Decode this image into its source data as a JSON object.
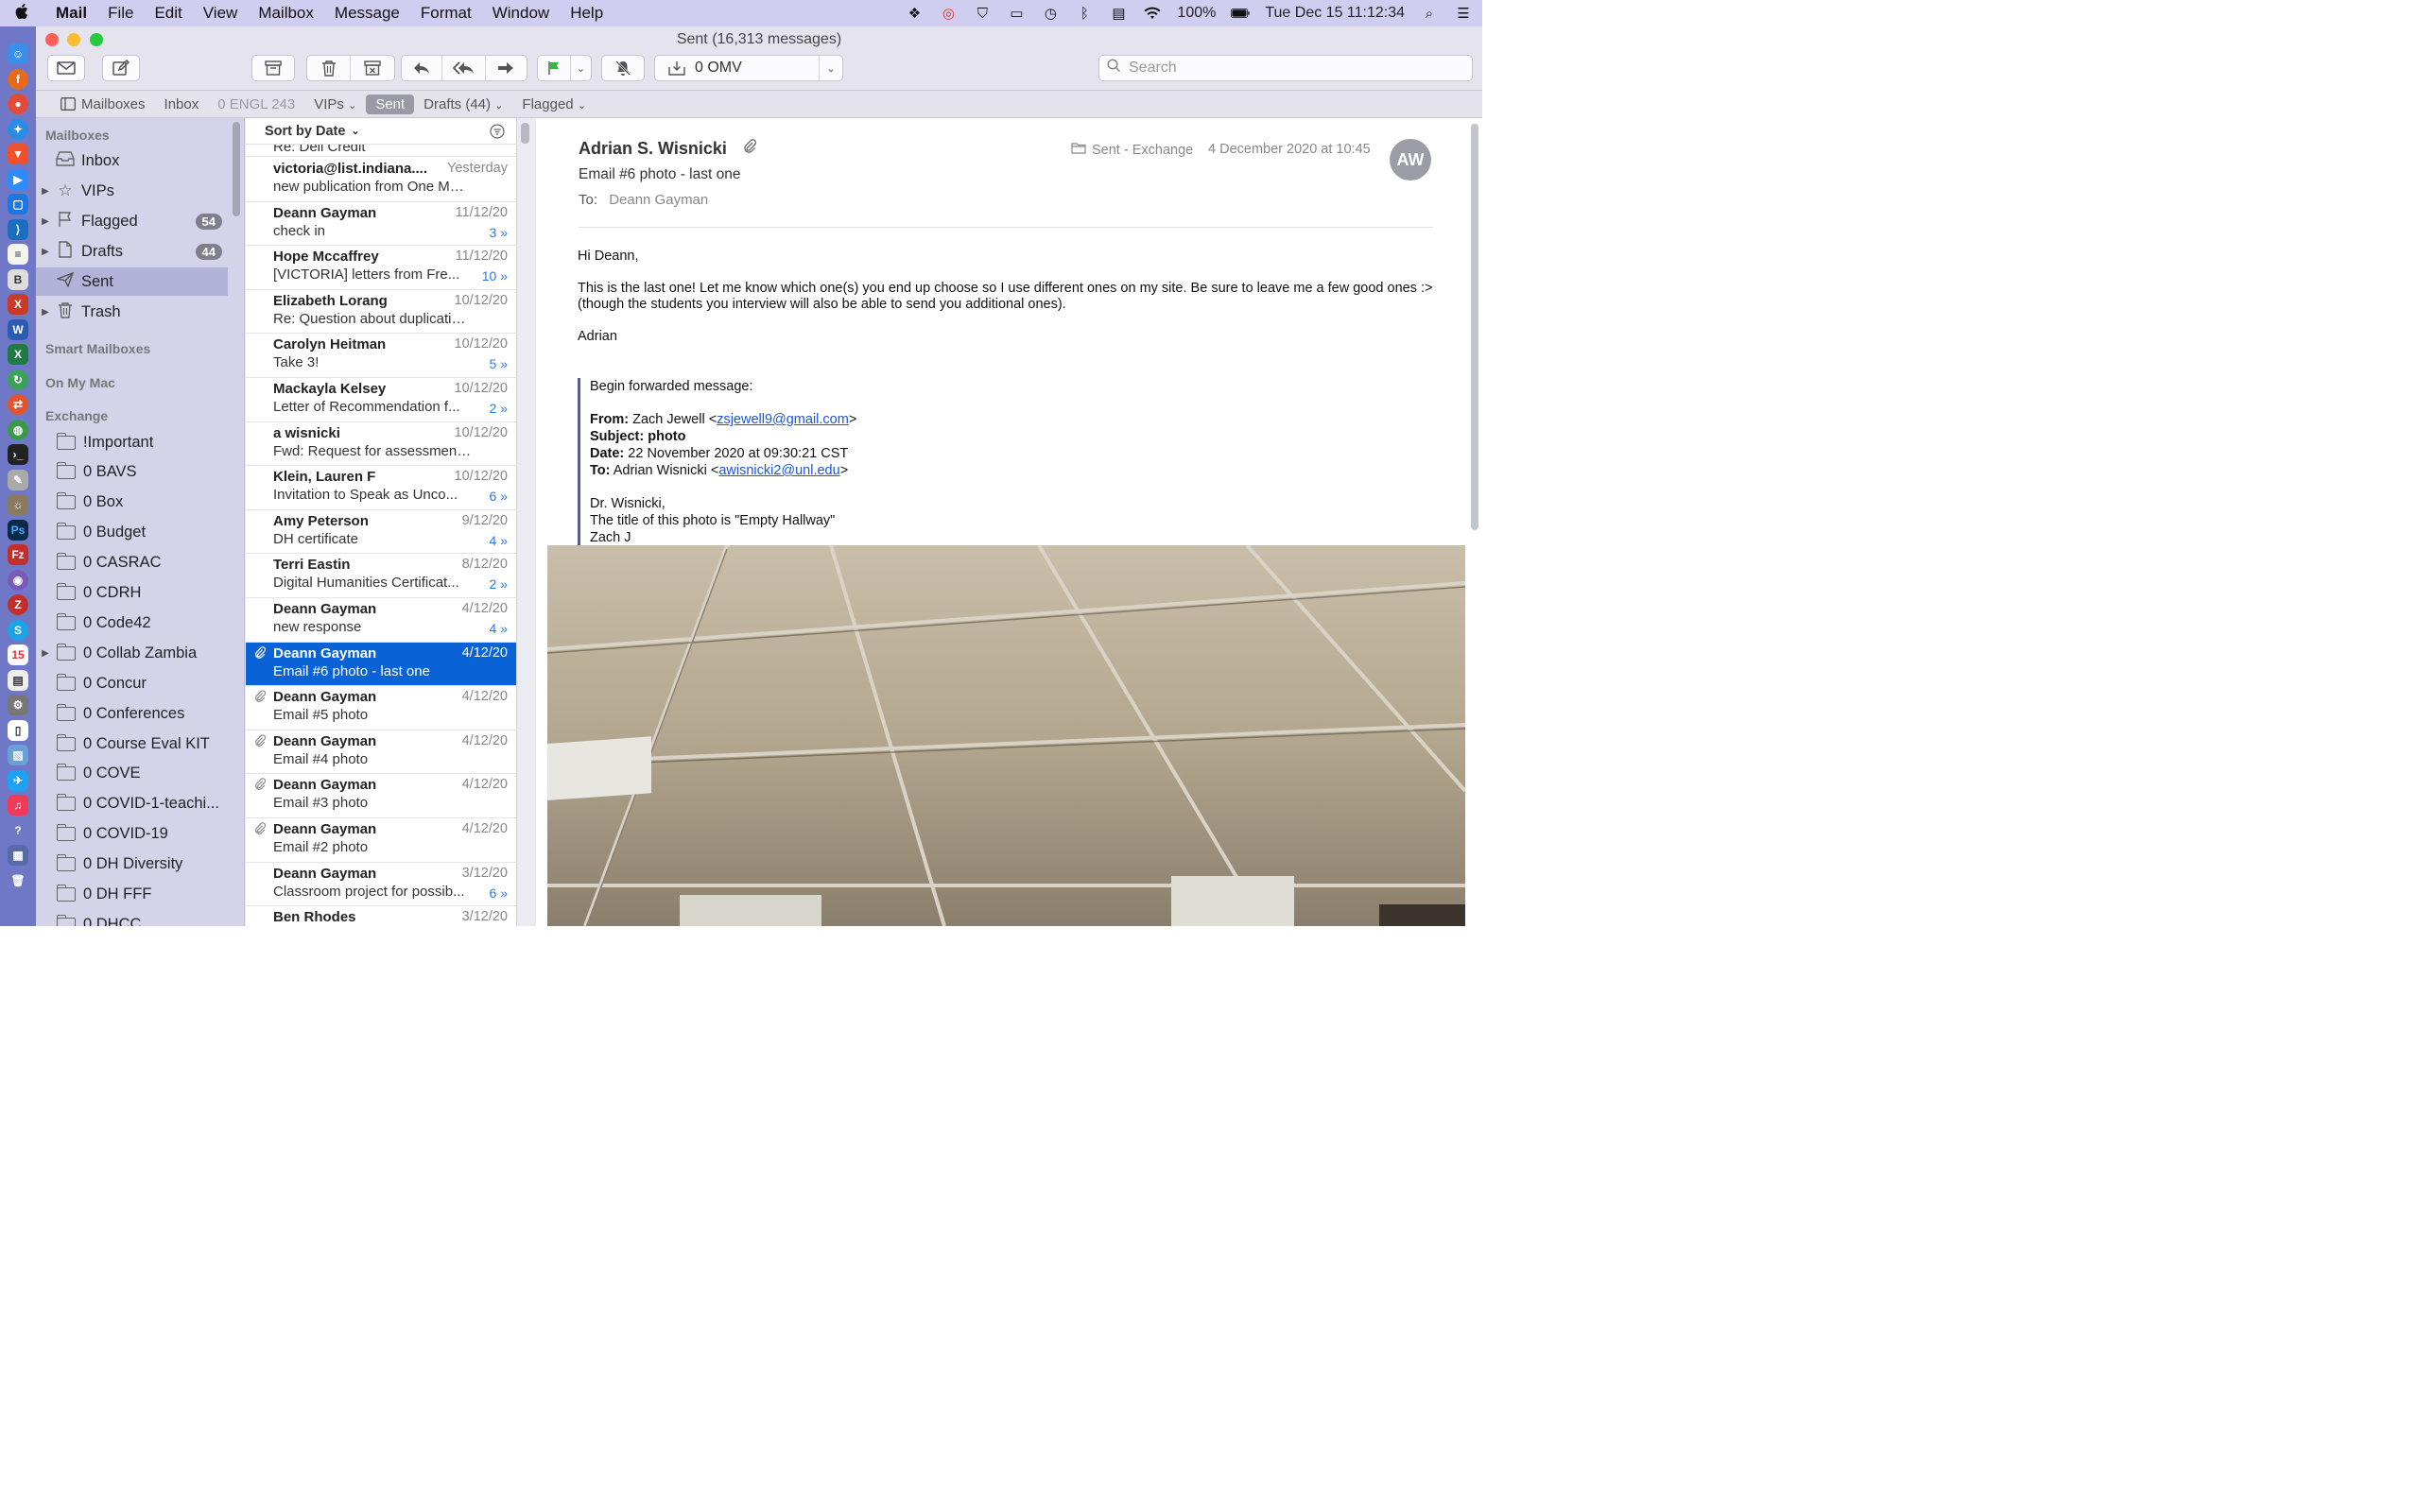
{
  "menubar": {
    "app": "Mail",
    "items": [
      "File",
      "Edit",
      "View",
      "Mailbox",
      "Message",
      "Format",
      "Window",
      "Help"
    ],
    "battery": "100%",
    "clock": "Tue Dec 15  11:12:34"
  },
  "window": {
    "title": "Sent (16,313 messages)"
  },
  "toolbar": {
    "mailbox_select": "0 OMV",
    "search_placeholder": "Search"
  },
  "favorites": {
    "mailboxes": "Mailboxes",
    "inbox": "Inbox",
    "engl": "0 ENGL 243",
    "vips": "VIPs",
    "sent": "Sent",
    "drafts": "Drafts (44)",
    "flagged": "Flagged"
  },
  "sidebar": {
    "section_mailboxes": "Mailboxes",
    "inbox": "Inbox",
    "vips": "VIPs",
    "flagged": "Flagged",
    "flagged_count": "54",
    "drafts": "Drafts",
    "drafts_count": "44",
    "sent": "Sent",
    "trash": "Trash",
    "section_smart": "Smart Mailboxes",
    "section_onmymac": "On My Mac",
    "section_exchange": "Exchange",
    "folders": [
      "!Important",
      "0 BAVS",
      "0 Box",
      "0 Budget",
      "0 CASRAC",
      "0 CDRH",
      "0 Code42",
      "0 Collab Zambia",
      "0 Concur",
      "0 Conferences",
      "0 Course Eval KIT",
      "0 COVE",
      "0 COVID-1-teachi...",
      "0 COVID-19",
      "0 DH Diversity",
      "0 DH FFF",
      "0 DHCC"
    ]
  },
  "list": {
    "sort_label": "Sort by Date",
    "partial_subject": "Re: Dell Credit",
    "messages": [
      {
        "from": "victoria@list.indiana....",
        "date": "Yesterday",
        "subject": "new publication from One More V...",
        "count": ""
      },
      {
        "from": "Deann Gayman",
        "date": "11/12/20",
        "subject": "check in",
        "count": "3 »"
      },
      {
        "from": "Hope Mccaffrey",
        "date": "11/12/20",
        "subject": "[VICTORIA] letters from Fre...",
        "count": "10 »"
      },
      {
        "from": "Elizabeth Lorang",
        "date": "10/12/20",
        "subject": "Re: Question about duplicating se...",
        "count": ""
      },
      {
        "from": "Carolyn Heitman",
        "date": "10/12/20",
        "subject": "Take 3!",
        "count": "5 »"
      },
      {
        "from": "Mackayla Kelsey",
        "date": "10/12/20",
        "subject": "Letter of Recommendation f...",
        "count": "2 »"
      },
      {
        "from": "a wisnicki",
        "date": "10/12/20",
        "subject": "Fwd: Request for assessment: So...",
        "count": ""
      },
      {
        "from": "Klein, Lauren F",
        "date": "10/12/20",
        "subject": "Invitation to Speak as Unco...",
        "count": "6 »"
      },
      {
        "from": "Amy Peterson",
        "date": "9/12/20",
        "subject": "DH certificate",
        "count": "4 »"
      },
      {
        "from": "Terri Eastin",
        "date": "8/12/20",
        "subject": "Digital Humanities Certificat...",
        "count": "2 »"
      },
      {
        "from": "Deann Gayman",
        "date": "4/12/20",
        "subject": "new response",
        "count": "4 »"
      },
      {
        "from": "Deann Gayman",
        "date": "4/12/20",
        "subject": "Email #6 photo - last one",
        "count": ""
      },
      {
        "from": "Deann Gayman",
        "date": "4/12/20",
        "subject": "Email #5 photo",
        "count": ""
      },
      {
        "from": "Deann Gayman",
        "date": "4/12/20",
        "subject": "Email #4 photo",
        "count": ""
      },
      {
        "from": "Deann Gayman",
        "date": "4/12/20",
        "subject": "Email #3 photo",
        "count": ""
      },
      {
        "from": "Deann Gayman",
        "date": "4/12/20",
        "subject": "Email #2 photo",
        "count": ""
      },
      {
        "from": "Deann Gayman",
        "date": "3/12/20",
        "subject": "Classroom project for possib...",
        "count": "6 »"
      },
      {
        "from": "Ben Rhodes",
        "date": "3/12/20",
        "subject": "",
        "count": ""
      }
    ]
  },
  "reader": {
    "from": "Adrian S. Wisnicki",
    "subject": "Email #6 photo - last one",
    "to_label": "To:",
    "to": "Deann Gayman",
    "folder": "Sent - Exchange",
    "date": "4 December 2020 at 10:45",
    "avatar": "AW",
    "greeting": "Hi Deann,",
    "body1": "This is the last one! Let me know which one(s) you end up choose so I use different ones on my site. Be sure to leave me a few good ones :> (though the students you interview will also be able to send you additional ones).",
    "signoff": "Adrian",
    "fwd_intro": "Begin forwarded message:",
    "fwd_from_label": "From:",
    "fwd_from_name": "Zach Jewell <",
    "fwd_from_email": "zsjewell9@gmail.com",
    "fwd_subject_label": "Subject:",
    "fwd_subject": "photo",
    "fwd_date_label": "Date:",
    "fwd_date": "22 November 2020 at 09:30:21 CST",
    "fwd_to_label": "To:",
    "fwd_to_name": "Adrian Wisnicki <",
    "fwd_to_email": "awisnicki2@unl.edu",
    "fwd_line1": "Dr. Wisnicki,",
    "fwd_line2": "The title of this photo is \"Empty Hallway\"",
    "fwd_line3": "Zach J"
  },
  "colors": {
    "menubar": "#cfcdf0",
    "dock": "#6e78c6",
    "selection": "#0a63d6",
    "link": "#1a57d6"
  }
}
